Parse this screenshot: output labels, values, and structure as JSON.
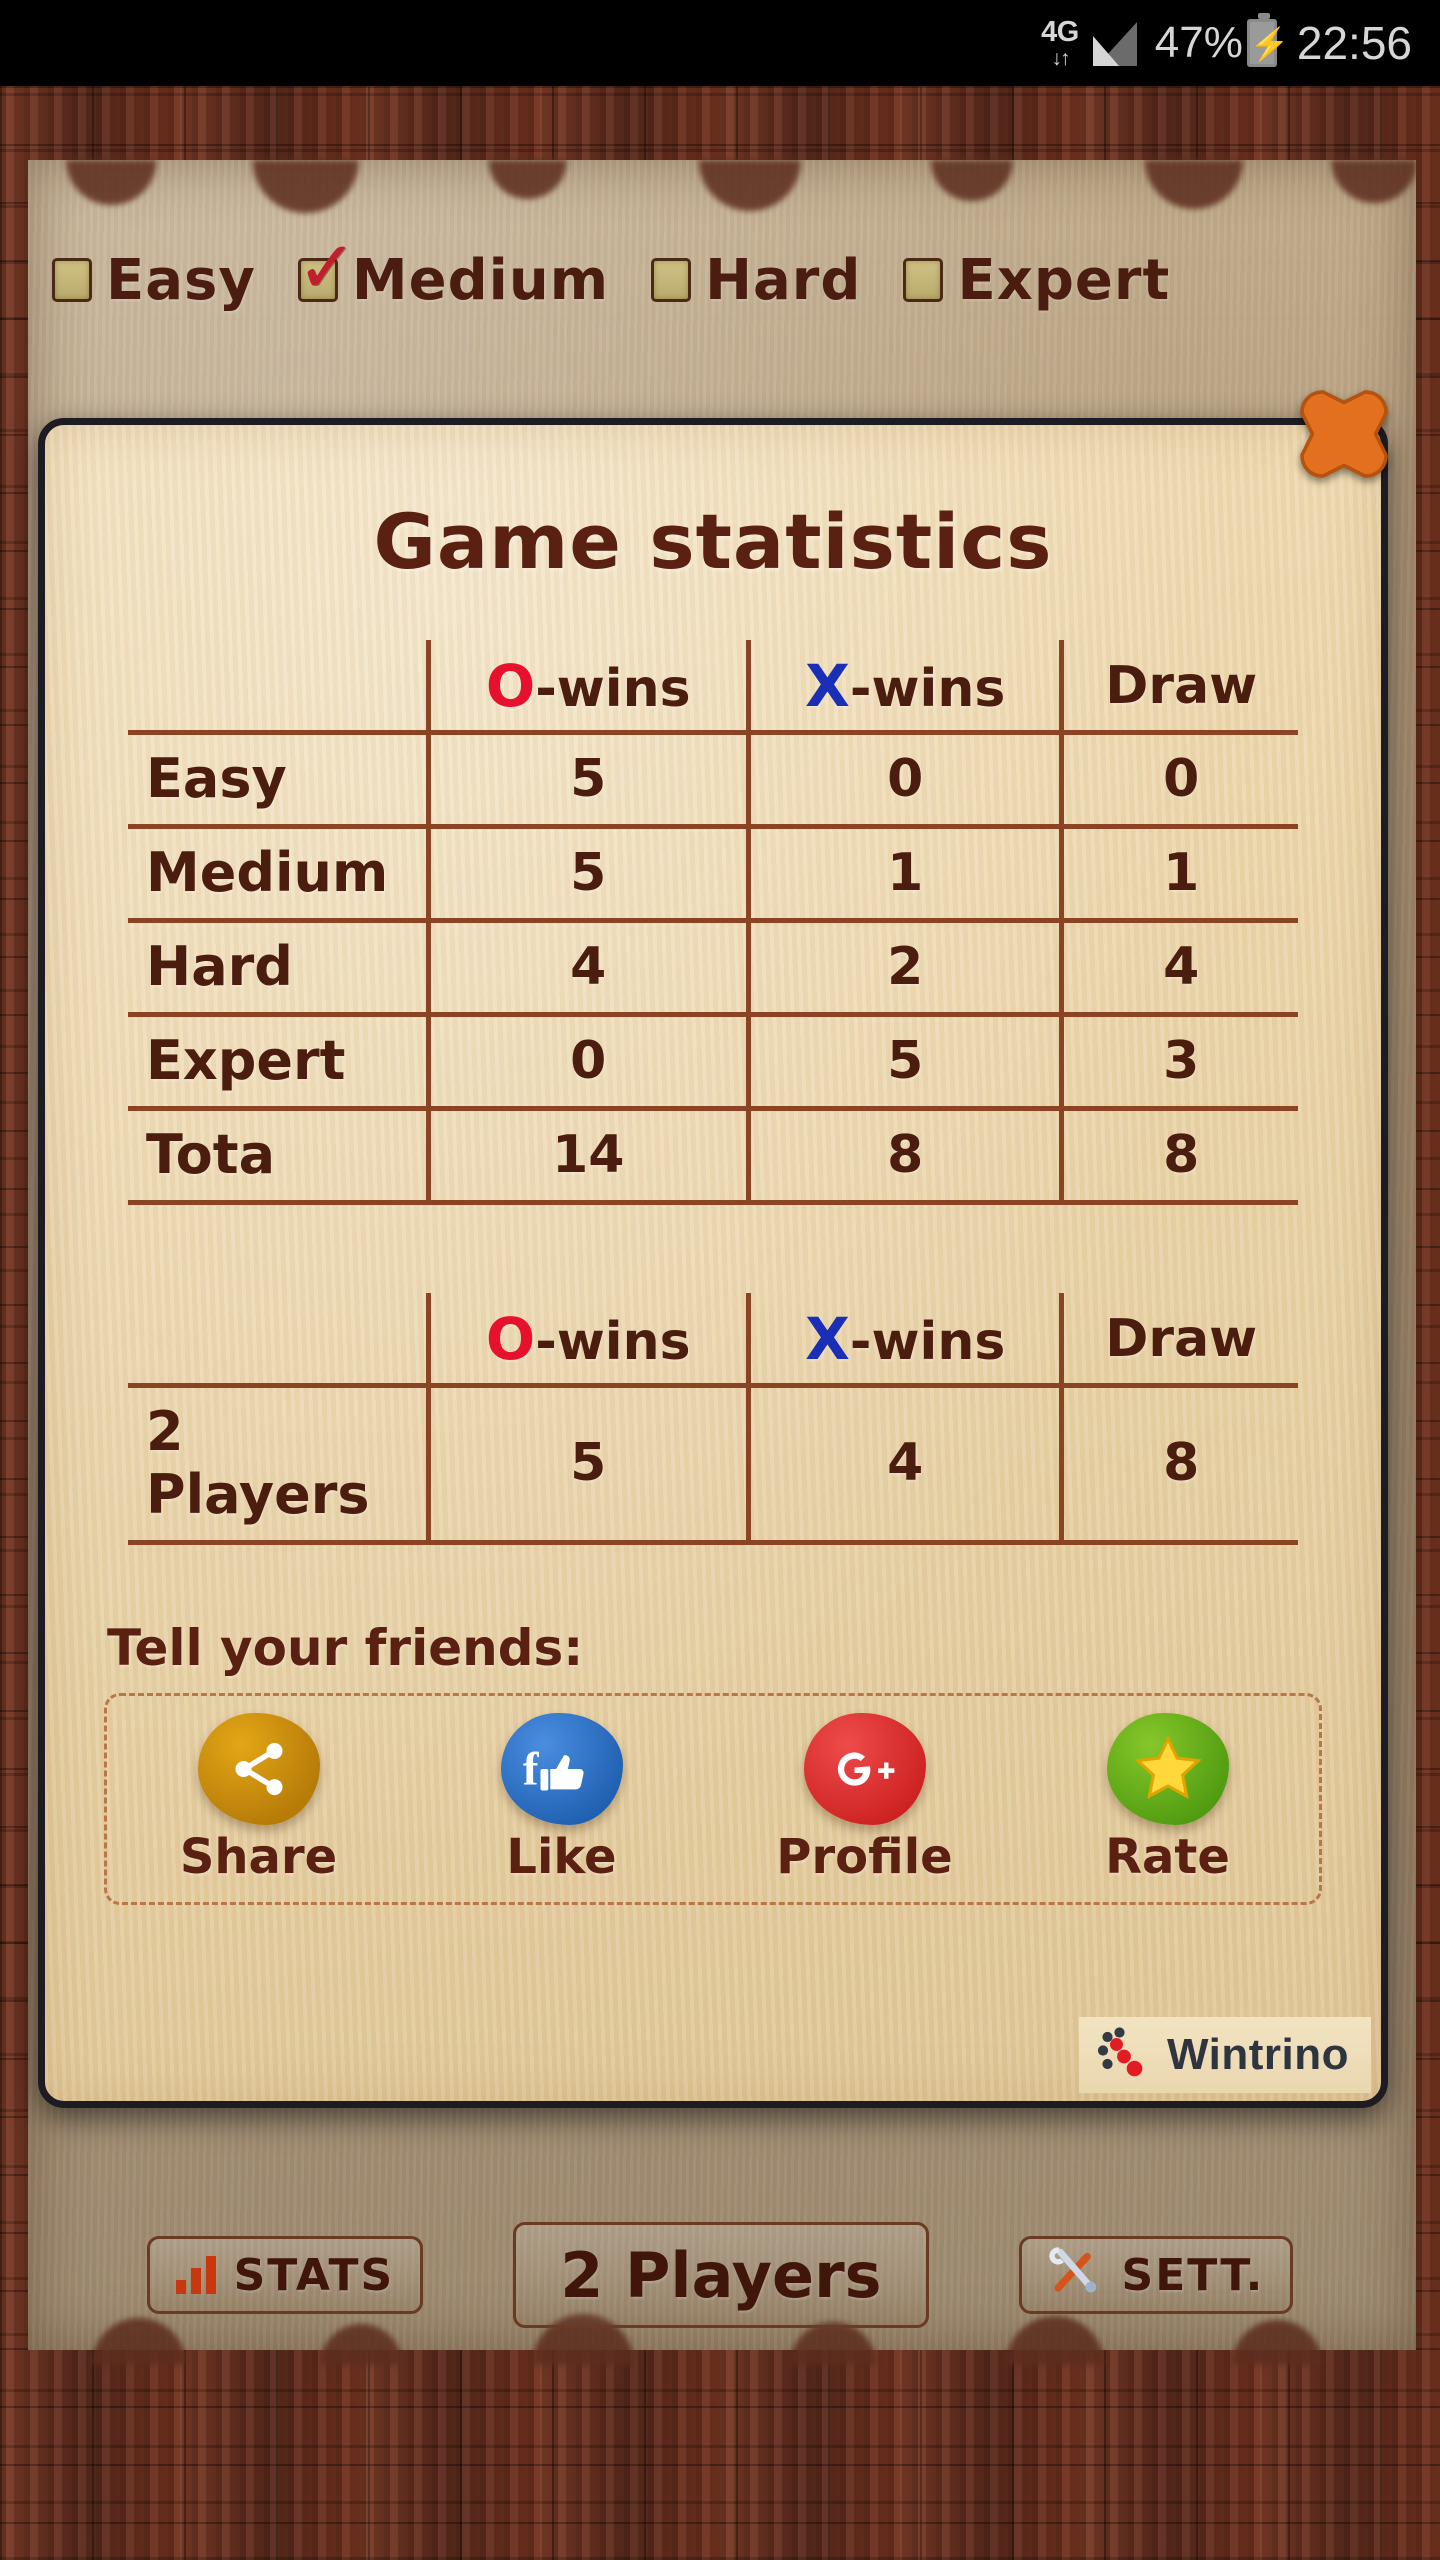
{
  "statusbar": {
    "network": "4G",
    "network_arrows": "↓↑",
    "battery_percent": "47%",
    "time": "22:56"
  },
  "difficulty": {
    "options": [
      {
        "label": "Easy",
        "checked": false
      },
      {
        "label": "Medium",
        "checked": true
      },
      {
        "label": "Hard",
        "checked": false
      },
      {
        "label": "Expert",
        "checked": false
      }
    ],
    "checkmark": "✓"
  },
  "dialog": {
    "title": "Game statistics",
    "close_label": "✖"
  },
  "chart_data": {
    "type": "table",
    "title": "Game statistics",
    "tables": [
      {
        "name": "single-player-by-difficulty",
        "columns": [
          "",
          "O-wins",
          "X-wins",
          "Draw"
        ],
        "col_marks": [
          "",
          "O",
          "X",
          ""
        ],
        "rows": [
          {
            "label": "Easy",
            "o_wins": "5",
            "x_wins": "0",
            "draw": "0"
          },
          {
            "label": "Medium",
            "o_wins": "5",
            "x_wins": "1",
            "draw": "1"
          },
          {
            "label": "Hard",
            "o_wins": "4",
            "x_wins": "2",
            "draw": "4"
          },
          {
            "label": "Expert",
            "o_wins": "0",
            "x_wins": "5",
            "draw": "3"
          },
          {
            "label": "Tota",
            "o_wins": "14",
            "x_wins": "8",
            "draw": "8"
          }
        ]
      },
      {
        "name": "two-player",
        "columns": [
          "",
          "O-wins",
          "X-wins",
          "Draw"
        ],
        "rows": [
          {
            "label": "2 Players",
            "o_wins": "5",
            "x_wins": "4",
            "draw": "8"
          }
        ]
      }
    ]
  },
  "tables": {
    "header_suffix": "-wins",
    "header_o_mark": "O",
    "header_x_mark": "X",
    "header_draw": "Draw",
    "main": {
      "rows": [
        {
          "label": "Easy",
          "o": "5",
          "x": "0",
          "d": "0"
        },
        {
          "label": "Medium",
          "o": "5",
          "x": "1",
          "d": "1"
        },
        {
          "label": "Hard",
          "o": "4",
          "x": "2",
          "d": "4"
        },
        {
          "label": "Expert",
          "o": "0",
          "x": "5",
          "d": "3"
        },
        {
          "label": "Tota",
          "o": "14",
          "x": "8",
          "d": "8"
        }
      ]
    },
    "two": {
      "rows": [
        {
          "label": "2 Players",
          "o": "5",
          "x": "4",
          "d": "8"
        }
      ]
    }
  },
  "share": {
    "heading": "Tell your friends:",
    "items": [
      {
        "label": "Share",
        "icon": "share-nodes-icon",
        "color": "#c98a0b"
      },
      {
        "label": "Like",
        "icon": "facebook-thumbs-up-icon",
        "color": "#2a6fc0"
      },
      {
        "label": "Profile",
        "icon": "google-plus-icon",
        "color": "#dd3131"
      },
      {
        "label": "Rate",
        "icon": "star-icon",
        "color": "#62ab15"
      }
    ]
  },
  "branding": {
    "name": "Wintrino"
  },
  "bottom_bar": {
    "stats_label": "STATS",
    "two_players_label": "2 Players",
    "settings_label": "SETT."
  }
}
